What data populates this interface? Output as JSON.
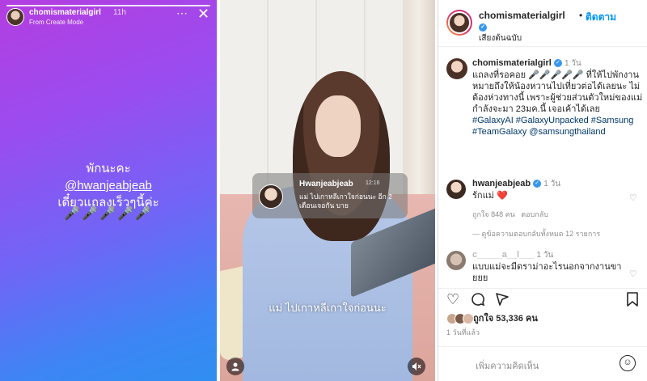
{
  "story": {
    "username": "chomismaterialgirl",
    "time": "11h",
    "mode": "From Create Mode",
    "more_icon": "⋯",
    "close_icon": "✕",
    "line1": "พักนะคะ",
    "mention": "@hwanjeabjeab",
    "line3": "เดี๋ยวแถลงเร็วๆนี้ค่ะ",
    "mics": "🎤🎤🎤🎤🎤"
  },
  "reel": {
    "notification": {
      "username": "Hwanjeabjeab",
      "time": "12:16",
      "message": "แม่ ไปเกาหลีเกาใจก่อนนะ อีก 2 เดือนเจอกัน บาย"
    },
    "caption": "แม่ ไปเกาหลีเกาใจก่อนนะ",
    "user_icon": "user-icon",
    "mute_icon": "mute-icon"
  },
  "post": {
    "header": {
      "username": "chomismaterialgirl",
      "follow": "ติดตาม",
      "dot": "•",
      "audio": "เสียงต้นฉบับ"
    },
    "caption": {
      "username": "chomismaterialgirl",
      "time": "1 วัน",
      "text": "แถลงที่รอคอย 🎤🎤🎤🎤🎤 ที่ให้ไปพักงาน หมายถึงให้น้องหวานไปเที่ยวต่อได้เลยนะ ไม่ต้องห่วงทางนี้ เพราะผู้ช่วยส่วนตัวใหม่ของแม่กำลังจะมา 23มค.นี้ เจอเค้าได้เลย",
      "tags": "#GalaxyAI #GalaxyUnpacked #Samsung #TeamGalaxy @samsungthailand"
    },
    "comment1": {
      "username": "hwanjeabjeab",
      "time": "1 วัน",
      "text": "รักแม่ ❤️",
      "likes": "ถูกใจ 848 คน",
      "reply": "ตอบกลับ"
    },
    "replies_label": "ดูข้อความตอบกลับทั้งหมด 12 รายการ",
    "comment2": {
      "username": "c_____a__l___",
      "time": "1 วัน",
      "text": "แบบแม่จะมีดราม่าอะไรนอกจากงานขายยย"
    },
    "likes_text": "ถูกใจ 53,336 คน",
    "date": "1 วันที่แล้ว",
    "add_comment_placeholder": "เพิ่มความคิดเห็น",
    "colors": {
      "accent": "#0095f6",
      "verified": "#3897f0",
      "tag": "#00376b",
      "heart": "#ed4956"
    }
  }
}
